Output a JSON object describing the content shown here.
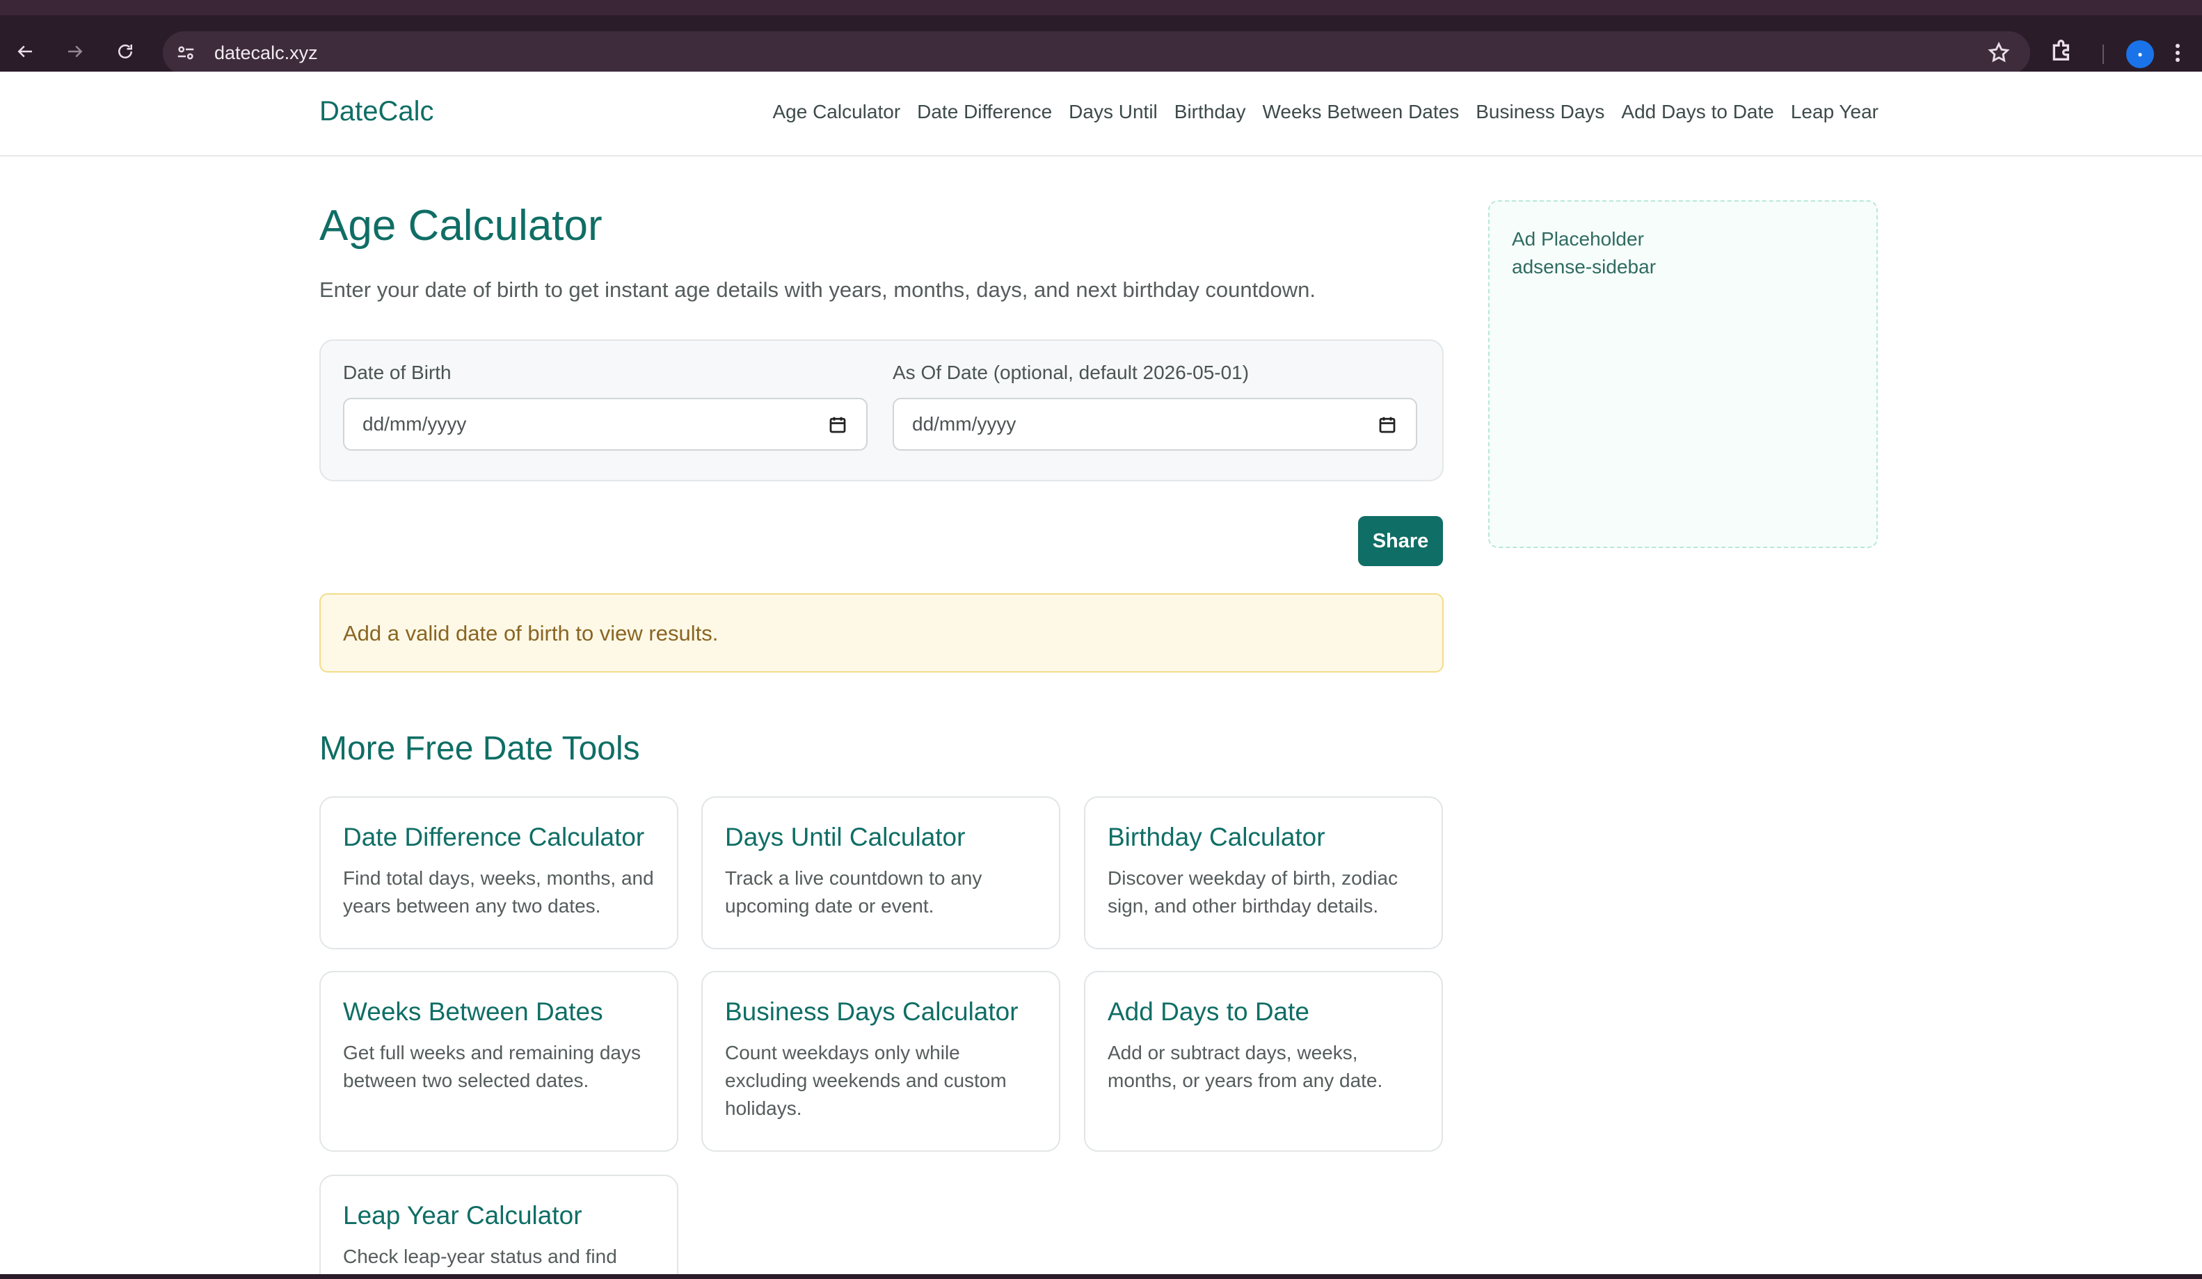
{
  "browser": {
    "url": "datecalc.xyz"
  },
  "header": {
    "logo": "DateCalc",
    "nav": [
      "Age Calculator",
      "Date Difference",
      "Days Until",
      "Birthday",
      "Weeks Between Dates",
      "Business Days",
      "Add Days to Date",
      "Leap Year"
    ]
  },
  "main": {
    "title": "Age Calculator",
    "intro": "Enter your date of birth to get instant age details with years, months, days, and next birthday countdown.",
    "form": {
      "dob_label": "Date of Birth",
      "dob_placeholder": "dd/mm/yyyy",
      "asof_label": "As Of Date (optional, default 2026-05-01)",
      "asof_placeholder": "dd/mm/yyyy"
    },
    "share_label": "Share",
    "notice": "Add a valid date of birth to view results.",
    "more_tools_title": "More Free Date Tools",
    "tools": [
      {
        "title": "Date Difference Calculator",
        "desc": "Find total days, weeks, months, and years between any two dates."
      },
      {
        "title": "Days Until Calculator",
        "desc": "Track a live countdown to any upcoming date or event."
      },
      {
        "title": "Birthday Calculator",
        "desc": "Discover weekday of birth, zodiac sign, and other birthday details."
      },
      {
        "title": "Weeks Between Dates",
        "desc": "Get full weeks and remaining days between two selected dates."
      },
      {
        "title": "Business Days Calculator",
        "desc": "Count weekdays only while excluding weekends and custom holidays."
      },
      {
        "title": "Add Days to Date",
        "desc": "Add or subtract days, weeks, months, or years from any date."
      },
      {
        "title": "Leap Year Calculator",
        "desc": "Check leap-year status and find"
      }
    ]
  },
  "sidebar": {
    "ad_line1": "Ad Placeholder",
    "ad_line2": "adsense-sidebar"
  },
  "icons": {
    "back": "back-arrow-icon",
    "forward": "forward-arrow-icon",
    "reload": "reload-icon",
    "site_info": "site-info-icon",
    "bookmark": "star-icon",
    "extensions": "puzzle-icon",
    "profile": "profile-icon",
    "menu": "kebab-menu-icon",
    "calendar": "calendar-icon"
  },
  "colors": {
    "brand": "#0f6e65",
    "browser_frame": "#2b1c2a",
    "notice_bg": "#fef9e7",
    "notice_text": "#8a6523"
  }
}
